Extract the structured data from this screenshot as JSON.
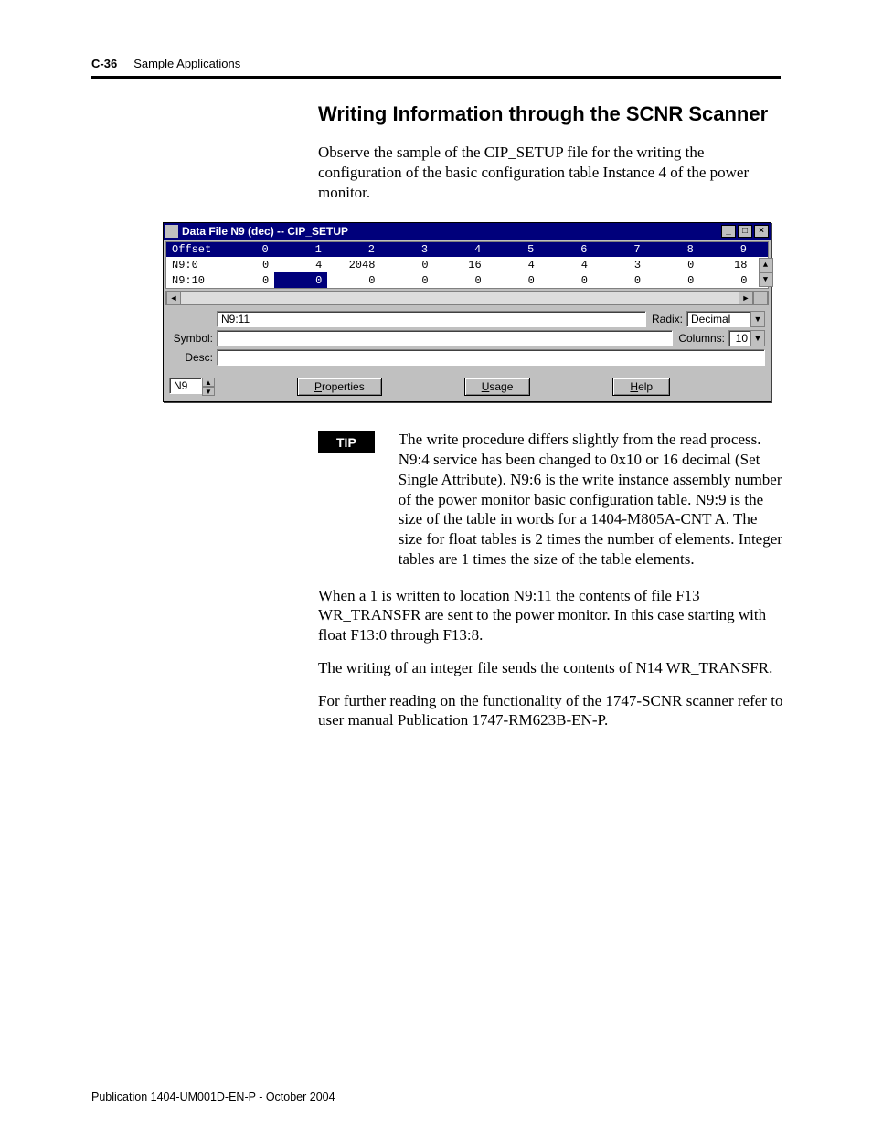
{
  "page": {
    "number": "C-36",
    "section": "Sample Applications"
  },
  "heading": "Writing Information through the SCNR Scanner",
  "intro": "Observe the sample of the CIP_SETUP file for the writing the configuration of  the basic configuration table Instance 4 of the power monitor.",
  "window": {
    "title": "Data File N9 (dec)  --  CIP_SETUP",
    "columns": [
      "Offset",
      "0",
      "1",
      "2",
      "3",
      "4",
      "5",
      "6",
      "7",
      "8",
      "9"
    ],
    "rows": [
      {
        "label": "N9:0",
        "cells": [
          "0",
          "4",
          "2048",
          "0",
          "16",
          "4",
          "4",
          "3",
          "0",
          "18"
        ]
      },
      {
        "label": "N9:10",
        "cells": [
          "0",
          "0",
          "0",
          "0",
          "0",
          "0",
          "0",
          "0",
          "0",
          "0"
        ],
        "selectedCol": 1
      }
    ],
    "address_field": "N9:11",
    "symbol_field": "",
    "desc_field": "",
    "radix_label": "Radix:",
    "radix_value": "Decimal",
    "columns_label": "Columns:",
    "columns_value": "10",
    "file_field": "N9",
    "buttons": {
      "properties": "Properties",
      "usage": "Usage",
      "help": "Help"
    },
    "labels": {
      "symbol": "Symbol:",
      "desc": "Desc:"
    }
  },
  "chart_data": {
    "type": "table",
    "title": "Data File N9 (dec)  --  CIP_SETUP",
    "columns": [
      "Offset",
      "0",
      "1",
      "2",
      "3",
      "4",
      "5",
      "6",
      "7",
      "8",
      "9"
    ],
    "rows": [
      [
        "N9:0",
        0,
        4,
        2048,
        0,
        16,
        4,
        4,
        3,
        0,
        18
      ],
      [
        "N9:10",
        0,
        0,
        0,
        0,
        0,
        0,
        0,
        0,
        0,
        0
      ]
    ],
    "selected_cell": {
      "row": "N9:10",
      "column": "1",
      "address": "N9:11"
    },
    "radix": "Decimal",
    "display_columns": 10
  },
  "tip": {
    "label": "TIP",
    "text": "The write procedure differs slightly from the read process.  N9:4 service has been changed to 0x10 or 16 decimal (Set Single Attribute).  N9:6 is the write instance assembly number of the power monitor basic configuration table.  N9:9 is the size of the table in words for a 1404-M805A-CNT A.  The size for float tables is 2 times the number of elements.  Integer tables are 1 times the size of the table elements."
  },
  "paras": {
    "p1": "When a 1 is written to location N9:11 the contents of file F13 WR_TRANSFR are sent to the power monitor.  In this case starting with float F13:0 through F13:8.",
    "p2": "The writing of an integer file sends the contents of  N14 WR_TRANSFR.",
    "p3": "For further reading on the functionality of the 1747-SCNR scanner refer to user manual Publication 1747-RM623B-EN-P."
  },
  "pubref": "Publication 1404-UM001D-EN-P - October 2004"
}
